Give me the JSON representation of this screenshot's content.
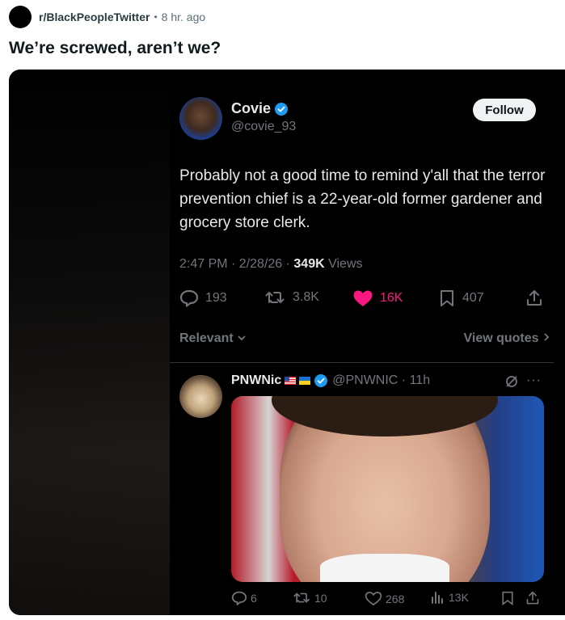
{
  "post": {
    "subreddit": "r/BlackPeopleTwitter",
    "separator": "•",
    "time": "8 hr. ago",
    "title": "We’re screwed, aren’t we?"
  },
  "tweet": {
    "name": "Covie",
    "handle": "@covie_93",
    "follow_label": "Follow",
    "text": "Probably not a good time to remind y'all that the terror prevention chief is a 22-year-old former gardener and grocery store clerk.",
    "time": "2:47 PM · 2/28/26 · ",
    "views_count": "349K",
    "views_label": " Views",
    "replies": "193",
    "reposts": "3.8K",
    "likes": "16K",
    "bookmarks": "407",
    "sort_label": "Relevant",
    "view_quotes": "View quotes"
  },
  "reply": {
    "name": "PNWNic",
    "handle": "@PNWNIC · 11h",
    "more": "···",
    "replies": "6",
    "reposts": "10",
    "likes": "268",
    "views": "13K"
  },
  "colors": {
    "verified": "#1d9bf0",
    "like": "#f91880",
    "muted": "#71767b",
    "text": "#e7e9ea"
  }
}
